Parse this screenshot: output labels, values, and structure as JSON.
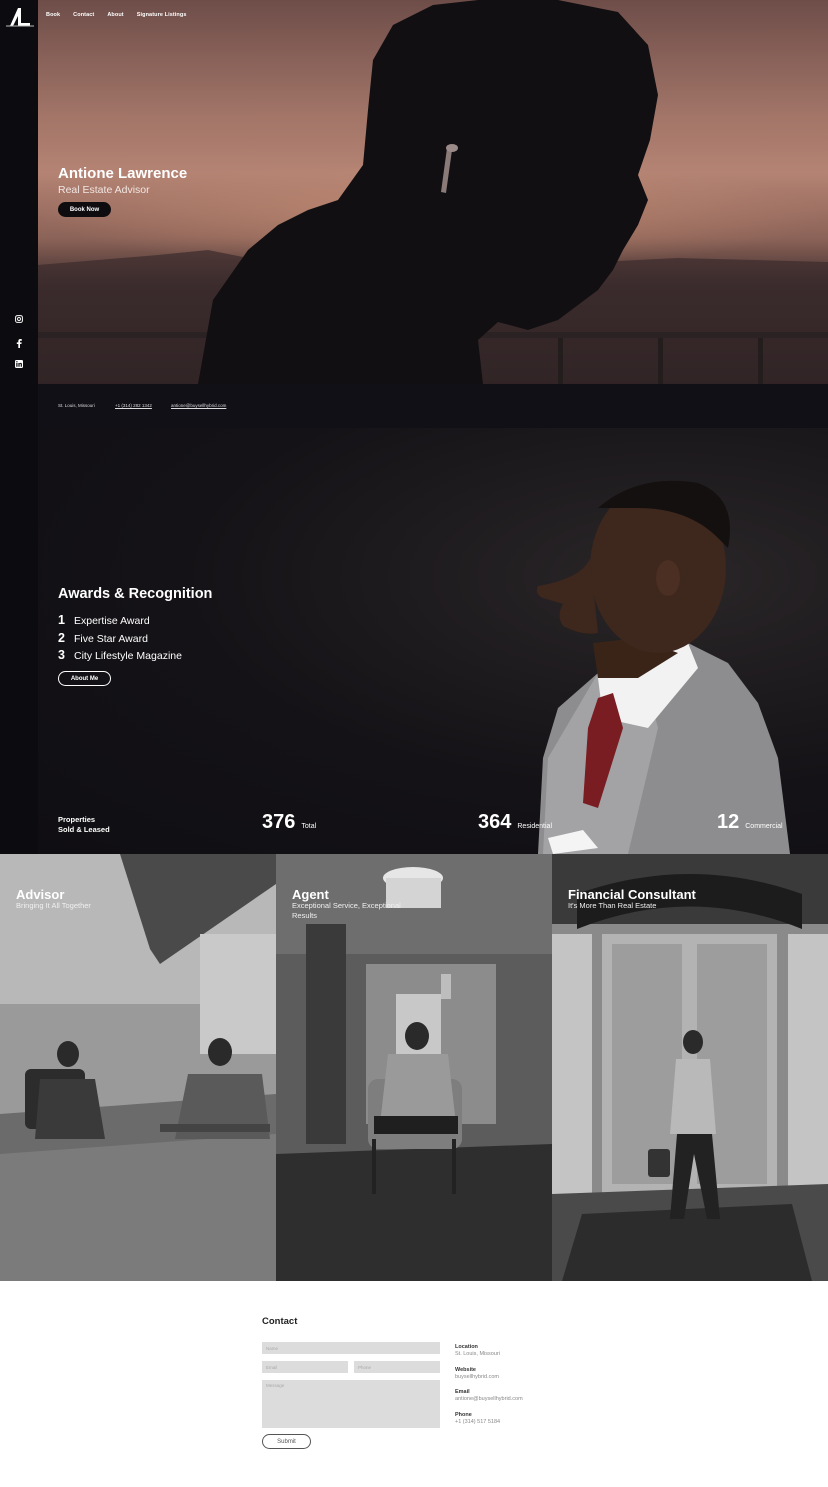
{
  "nav": {
    "items": [
      "Book",
      "Contact",
      "About",
      "Signature Listings"
    ]
  },
  "social": {
    "icons": [
      "instagram-icon",
      "facebook-icon",
      "linkedin-icon"
    ]
  },
  "hero": {
    "name": "Antione Lawrence",
    "role": "Real Estate Advisor",
    "button": "Book Now"
  },
  "infobar": {
    "location": "St. Louis, Missouri",
    "phone": "+1 (314) 282 1342",
    "email": "antione@buysellhybrid.com"
  },
  "awards": {
    "title": "Awards & Recognition",
    "items": [
      {
        "num": "1",
        "label": "Expertise Award"
      },
      {
        "num": "2",
        "label": "Five Star Award"
      },
      {
        "num": "3",
        "label": "City Lifestyle Magazine"
      }
    ],
    "button": "About Me",
    "properties_label_1": "Properties",
    "properties_label_2": "Sold & Leased",
    "stats": [
      {
        "value": "376",
        "label": "Total"
      },
      {
        "value": "364",
        "label": "Residential"
      },
      {
        "value": "12",
        "label": "Commercial"
      }
    ]
  },
  "panels": [
    {
      "title": "Advisor",
      "subtitle": "Bringing It All Together"
    },
    {
      "title": "Agent",
      "subtitle": "Exceptional Service, Exceptional Results"
    },
    {
      "title": "Financial Consultant",
      "subtitle": "It's More Than Real Estate"
    }
  ],
  "contact": {
    "title": "Contact",
    "placeholders": {
      "name": "Name",
      "email": "Email",
      "phone": "Phone",
      "message": "Message"
    },
    "submit": "Submit",
    "info": [
      {
        "key": "Location",
        "value": "St. Louis, Missouri"
      },
      {
        "key": "Website",
        "value": "buysellhybrid.com"
      },
      {
        "key": "Email",
        "value": "antione@buysellhybrid.com"
      },
      {
        "key": "Phone",
        "value": "+1 (314) 517 5184"
      }
    ]
  }
}
